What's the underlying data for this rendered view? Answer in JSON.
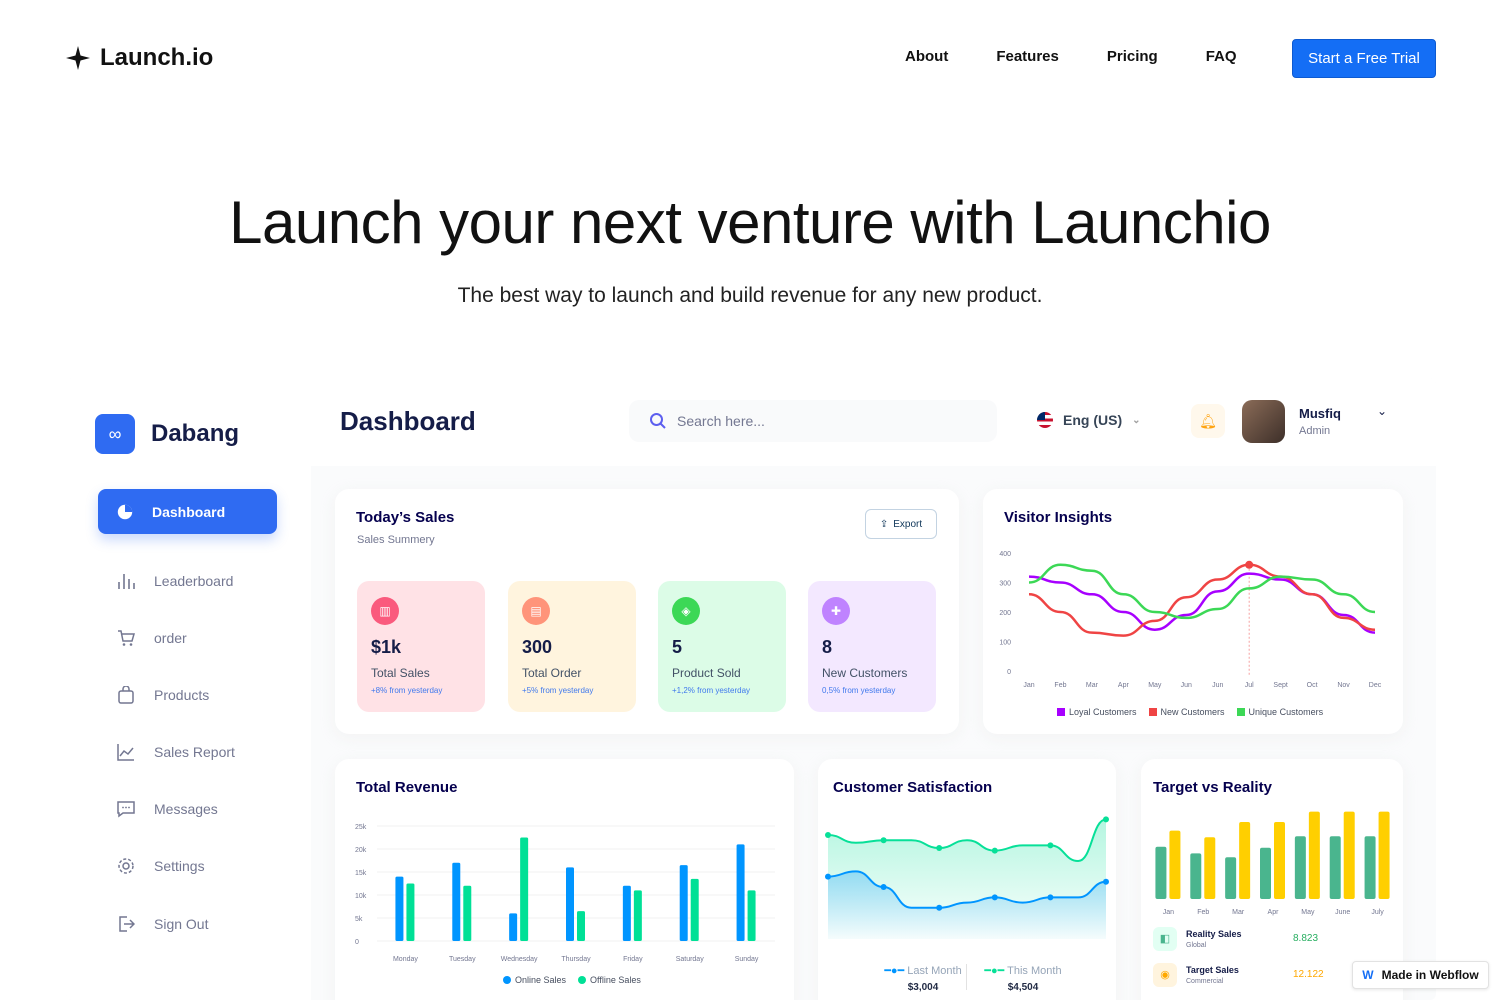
{
  "nav": {
    "logo": "Launch.io",
    "links": [
      "About",
      "Features",
      "Pricing",
      "FAQ"
    ],
    "cta": "Start a Free Trial"
  },
  "hero": {
    "title": "Launch your next venture with Launchio",
    "subtitle": "The best way to launch and build revenue for any new product."
  },
  "dashboard": {
    "brand": "Dabang",
    "title": "Dashboard",
    "search_placeholder": "Search here...",
    "language": "Eng (US)",
    "user": {
      "name": "Musfiq",
      "role": "Admin"
    },
    "sidebar": [
      {
        "label": "Dashboard",
        "icon": "pie-chart-icon"
      },
      {
        "label": "Leaderboard",
        "icon": "bars-icon"
      },
      {
        "label": "order",
        "icon": "cart-icon"
      },
      {
        "label": "Products",
        "icon": "bag-icon"
      },
      {
        "label": "Sales Report",
        "icon": "line-chart-icon"
      },
      {
        "label": "Messages",
        "icon": "message-icon"
      },
      {
        "label": "Settings",
        "icon": "gear-icon"
      },
      {
        "label": "Sign Out",
        "icon": "sign-out-icon"
      }
    ],
    "todays_sales": {
      "title": "Today’s Sales",
      "subtitle": "Sales Summery",
      "export": "Export",
      "stats": [
        {
          "value": "$1k",
          "label": "Total Sales",
          "change": "+8% from yesterday",
          "bg": "#ffe2e6",
          "icon_color": "#fa5a7d"
        },
        {
          "value": "300",
          "label": "Total Order",
          "change": "+5% from yesterday",
          "bg": "#fff4de",
          "icon_color": "#ff947a"
        },
        {
          "value": "5",
          "label": "Product Sold",
          "change": "+1,2% from yesterday",
          "bg": "#dcfce7",
          "icon_color": "#3cd856"
        },
        {
          "value": "8",
          "label": "New Customers",
          "change": "0,5% from yesterday",
          "bg": "#f3e8ff",
          "icon_color": "#bf83ff"
        }
      ]
    },
    "visitor_insights": {
      "title": "Visitor Insights",
      "legend": [
        "Loyal Customers",
        "New Customers",
        "Unique Customers"
      ]
    },
    "total_revenue": {
      "title": "Total Revenue",
      "legend": [
        "Online Sales",
        "Offline Sales"
      ]
    },
    "customer_satisfaction": {
      "title": "Customer Satisfaction",
      "legend": [
        {
          "label": "Last Month",
          "value": "$3,004"
        },
        {
          "label": "This Month",
          "value": "$4,504"
        }
      ]
    },
    "target_vs_reality": {
      "title": "Target vs Reality",
      "rows": [
        {
          "label": "Reality Sales",
          "sub": "Global",
          "value": "8.823"
        },
        {
          "label": "Target Sales",
          "sub": "Commercial",
          "value": "12.122"
        }
      ]
    }
  },
  "chart_data": [
    {
      "type": "line",
      "title": "Visitor Insights",
      "categories": [
        "Jan",
        "Feb",
        "Mar",
        "Apr",
        "May",
        "Jun",
        "Jun",
        "Jul",
        "Sept",
        "Oct",
        "Nov",
        "Dec"
      ],
      "yticks": [
        0,
        100,
        200,
        300,
        400
      ],
      "ylim": [
        0,
        400
      ],
      "series": [
        {
          "name": "Loyal Customers",
          "color": "#a700ff",
          "values": [
            320,
            300,
            260,
            200,
            140,
            190,
            270,
            330,
            310,
            260,
            190,
            130
          ]
        },
        {
          "name": "New Customers",
          "color": "#ef4444",
          "values": [
            260,
            200,
            130,
            120,
            170,
            250,
            310,
            360,
            320,
            260,
            180,
            140
          ]
        },
        {
          "name": "Unique Customers",
          "color": "#3cd856",
          "values": [
            300,
            360,
            340,
            260,
            200,
            180,
            210,
            280,
            320,
            310,
            260,
            200
          ]
        }
      ]
    },
    {
      "type": "bar",
      "title": "Total Revenue",
      "categories": [
        "Monday",
        "Tuesday",
        "Wednesday",
        "Thursday",
        "Friday",
        "Saturday",
        "Sunday"
      ],
      "yticks": [
        "0",
        "5k",
        "10k",
        "15k",
        "20k",
        "25k"
      ],
      "ylim": [
        0,
        25000
      ],
      "series": [
        {
          "name": "Online Sales",
          "color": "#0095ff",
          "values": [
            14000,
            17000,
            6000,
            16000,
            12000,
            16500,
            21000
          ]
        },
        {
          "name": "Offline Sales",
          "color": "#00e096",
          "values": [
            12500,
            12000,
            22500,
            6500,
            11000,
            13500,
            11000
          ]
        }
      ]
    },
    {
      "type": "area",
      "title": "Customer Satisfaction",
      "series": [
        {
          "name": "Last Month",
          "color": "#0095ff",
          "values": [
            2.4,
            2.6,
            2.0,
            1.2,
            1.2,
            1.4,
            1.6,
            1.4,
            1.6,
            1.6,
            2.2
          ]
        },
        {
          "name": "This Month",
          "color": "#07e098",
          "values": [
            4.0,
            3.7,
            3.8,
            3.8,
            3.5,
            3.8,
            3.4,
            3.6,
            3.6,
            3.0,
            4.6
          ]
        }
      ]
    },
    {
      "type": "bar",
      "title": "Target vs Reality",
      "categories": [
        "Jan",
        "Feb",
        "Mar",
        "Apr",
        "May",
        "June",
        "July"
      ],
      "series": [
        {
          "name": "Reality Sales",
          "color": "#4ab58e",
          "values": [
            5.5,
            4.8,
            4.4,
            5.4,
            6.6,
            6.6,
            6.6
          ]
        },
        {
          "name": "Target Sales",
          "color": "#ffcf00",
          "values": [
            7.2,
            6.5,
            8.1,
            8.1,
            9.2,
            9.2,
            9.2
          ]
        }
      ]
    }
  ]
}
